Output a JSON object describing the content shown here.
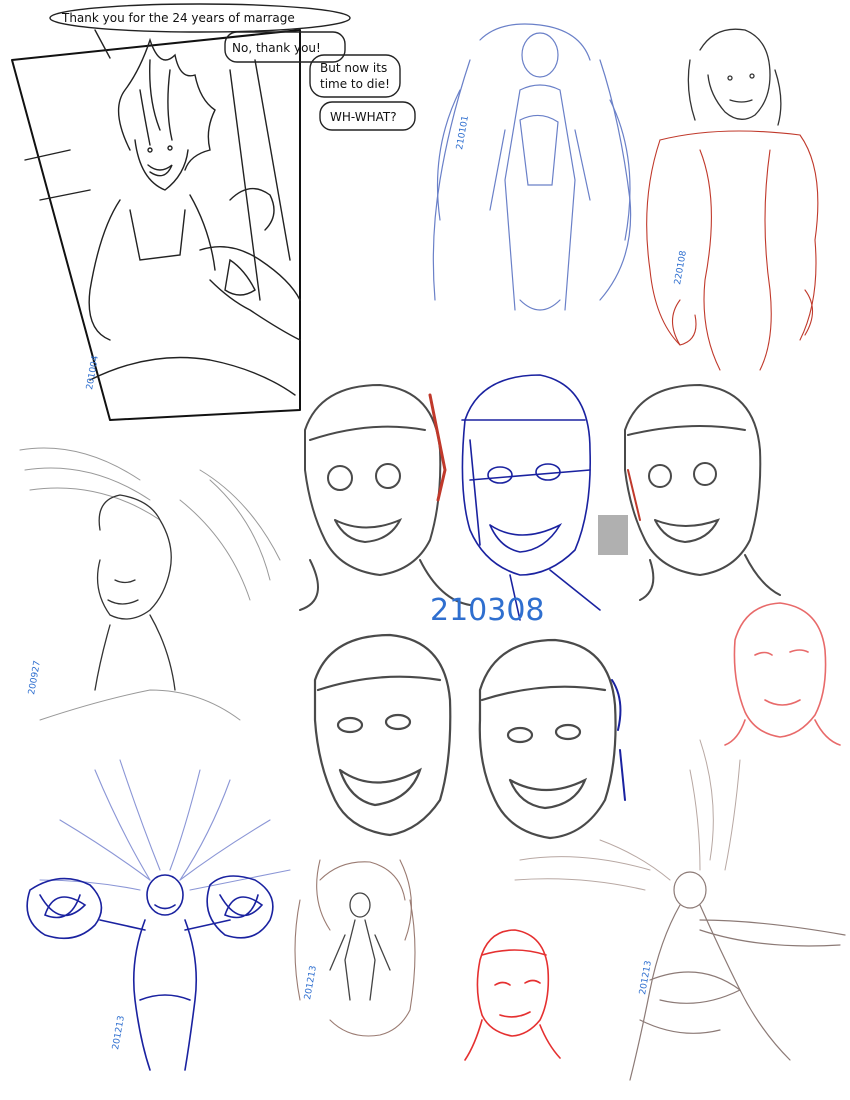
{
  "comic": {
    "bubble_1": "Thank you for the 24 years of marrage",
    "bubble_2": "No, thank you!",
    "bubble_3_line1": "But now its",
    "bubble_3_line2": "time to die!",
    "bubble_4": "WH-WHAT?"
  },
  "date_stamps": {
    "comic": "201004",
    "blue_figure": "210101",
    "red_figure": "220108",
    "winged_profile": "200927",
    "head_studies": "210308",
    "blue_wings": "201213",
    "brown_figure": "201213",
    "winged_dancer": "201213"
  },
  "colors": {
    "ink": "#4a4a4a",
    "dark_ink": "#222222",
    "blue_sketch": "#6a80c8",
    "navy_ink": "#1a22a0",
    "red_sketch": "#c0392b",
    "bright_red": "#e53030",
    "pink_sketch": "#e86a6a",
    "brown_sketch": "#9a7b72",
    "date_blue": "#2f6fcf"
  }
}
